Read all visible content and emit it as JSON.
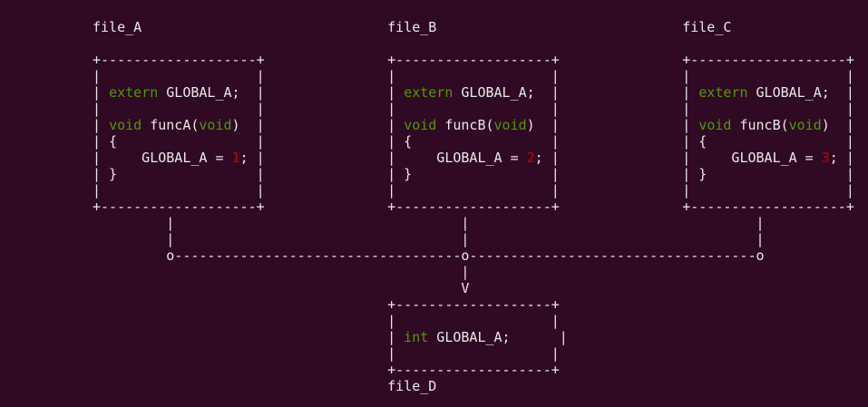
{
  "diagram": {
    "lines": [
      [
        {
          "t": "file_A                              file_B                              file_C",
          "c": "plain"
        }
      ],
      [],
      [
        {
          "t": "+-------------------+               +-------------------+               +-------------------+",
          "c": "plain"
        }
      ],
      [
        {
          "t": "|                   |               |                   |               |                   |",
          "c": "plain"
        }
      ],
      [
        {
          "t": "| ",
          "c": "plain"
        },
        {
          "t": "extern",
          "c": "kw"
        },
        {
          "t": " GLOBAL_A;  |               | ",
          "c": "plain"
        },
        {
          "t": "extern",
          "c": "kw"
        },
        {
          "t": " GLOBAL_A;  |               | ",
          "c": "plain"
        },
        {
          "t": "extern",
          "c": "kw"
        },
        {
          "t": " GLOBAL_A;  |",
          "c": "plain"
        }
      ],
      [
        {
          "t": "|                   |               |                   |               |                   |",
          "c": "plain"
        }
      ],
      [
        {
          "t": "| ",
          "c": "plain"
        },
        {
          "t": "void",
          "c": "kw"
        },
        {
          "t": " funcA(",
          "c": "plain"
        },
        {
          "t": "void",
          "c": "kw"
        },
        {
          "t": ")  |               | ",
          "c": "plain"
        },
        {
          "t": "void",
          "c": "kw"
        },
        {
          "t": " funcB(",
          "c": "plain"
        },
        {
          "t": "void",
          "c": "kw"
        },
        {
          "t": ")  |               | ",
          "c": "plain"
        },
        {
          "t": "void",
          "c": "kw"
        },
        {
          "t": " funcB(",
          "c": "plain"
        },
        {
          "t": "void",
          "c": "kw"
        },
        {
          "t": ")  |",
          "c": "plain"
        }
      ],
      [
        {
          "t": "| {                 |               | {                 |               | {                 |",
          "c": "plain"
        }
      ],
      [
        {
          "t": "|     GLOBAL_A = ",
          "c": "plain"
        },
        {
          "t": "1",
          "c": "num"
        },
        {
          "t": "; |               |     GLOBAL_A = ",
          "c": "plain"
        },
        {
          "t": "2",
          "c": "num"
        },
        {
          "t": "; |               |     GLOBAL_A = ",
          "c": "plain"
        },
        {
          "t": "3",
          "c": "num"
        },
        {
          "t": "; |",
          "c": "plain"
        }
      ],
      [
        {
          "t": "| }                 |               | }                 |               | }                 |",
          "c": "plain"
        }
      ],
      [
        {
          "t": "|                   |               |                   |               |                   |",
          "c": "plain"
        }
      ],
      [
        {
          "t": "+-------------------+               +-------------------+               +-------------------+",
          "c": "plain"
        }
      ],
      [
        {
          "t": "         |                                   |                                   |",
          "c": "plain"
        }
      ],
      [
        {
          "t": "         |                                   |                                   |",
          "c": "plain"
        }
      ],
      [
        {
          "t": "         o-----------------------------------o-----------------------------------o",
          "c": "plain"
        }
      ],
      [
        {
          "t": "                                             |",
          "c": "plain"
        }
      ],
      [
        {
          "t": "                                             V",
          "c": "plain"
        }
      ],
      [
        {
          "t": "                                    +-------------------+",
          "c": "plain"
        }
      ],
      [
        {
          "t": "                                    |                   |",
          "c": "plain"
        }
      ],
      [
        {
          "t": "                                    | ",
          "c": "plain"
        },
        {
          "t": "int",
          "c": "kw"
        },
        {
          "t": " GLOBAL_A;      |",
          "c": "plain"
        }
      ],
      [
        {
          "t": "                                    |                   |",
          "c": "plain"
        }
      ],
      [
        {
          "t": "                                    +-------------------+",
          "c": "plain"
        }
      ],
      [
        {
          "t": "                                    file_D",
          "c": "plain"
        }
      ]
    ]
  },
  "colors": {
    "background": "#300a24",
    "text": "#e8e8e8",
    "keyword": "#4e9a06",
    "number": "#cc0000"
  }
}
